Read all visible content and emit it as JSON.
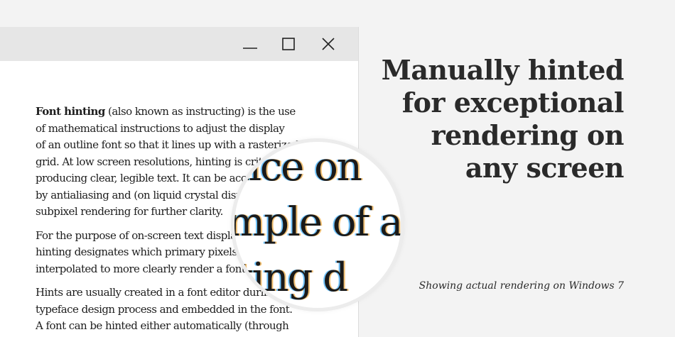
{
  "window": {
    "buttons": {
      "minimize_icon": "minimize-icon",
      "maximize_icon": "maximize-icon",
      "close_icon": "close-icon"
    },
    "document": {
      "paragraphs": [
        {
          "lines": [
            {
              "bold": "Font hinting",
              "text": " (also known as instructing) is the use"
            },
            {
              "text": "of mathematical instructions to adjust the display"
            },
            {
              "text": "of an outline font so that it lines up with a rasterized"
            },
            {
              "text": "grid. At low screen resolutions, hinting is critical for"
            },
            {
              "text": "producing clear, legible text. It can be accompanied"
            },
            {
              "text": "by antialiasing and (on liquid crystal displays)"
            },
            {
              "text": "subpixel rendering for further clarity."
            }
          ]
        },
        {
          "lines": [
            {
              "text": "For the purpose of on-screen text display, font"
            },
            {
              "text": "hinting designates which primary pixels are"
            },
            {
              "text": "interpolated to more clearly render a font."
            }
          ]
        },
        {
          "lines": [
            {
              "text": "Hints are usually created in a font editor during the"
            },
            {
              "text": "typeface design process and embedded in the font."
            },
            {
              "text": "A font can be hinted either automatically (through"
            }
          ]
        }
      ]
    }
  },
  "magnifier": {
    "lines": [
      "lice on",
      "mple of a",
      "nting d"
    ]
  },
  "headline": {
    "lines": [
      "Manually hinted",
      "for exceptional",
      "rendering on",
      "any screen"
    ]
  },
  "caption": "Showing actual rendering on Windows 7"
}
